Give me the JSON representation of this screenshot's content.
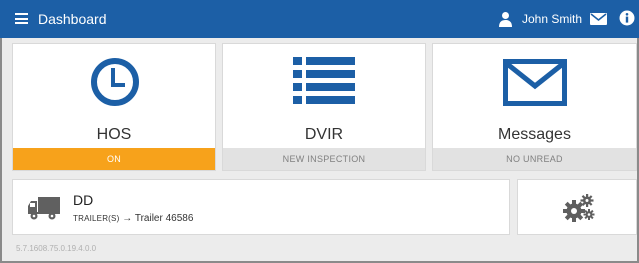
{
  "header": {
    "title": "Dashboard",
    "user_name": "John Smith",
    "accent": "#1c5fa6"
  },
  "tiles": [
    {
      "label": "HOS",
      "status": "ON",
      "icon": "clock-icon",
      "status_color": "#f7a21b"
    },
    {
      "label": "DVIR",
      "status": "NEW INSPECTION",
      "icon": "list-icon"
    },
    {
      "label": "Messages",
      "status": "NO UNREAD",
      "icon": "envelope-icon"
    }
  ],
  "vehicle": {
    "name": "DD",
    "trailer_prefix": "TRAILER(S)",
    "trailer_arrow": "→",
    "trailer_value": "Trailer 46586"
  },
  "version": "5.7.1608.75.0.19.4.0.0"
}
